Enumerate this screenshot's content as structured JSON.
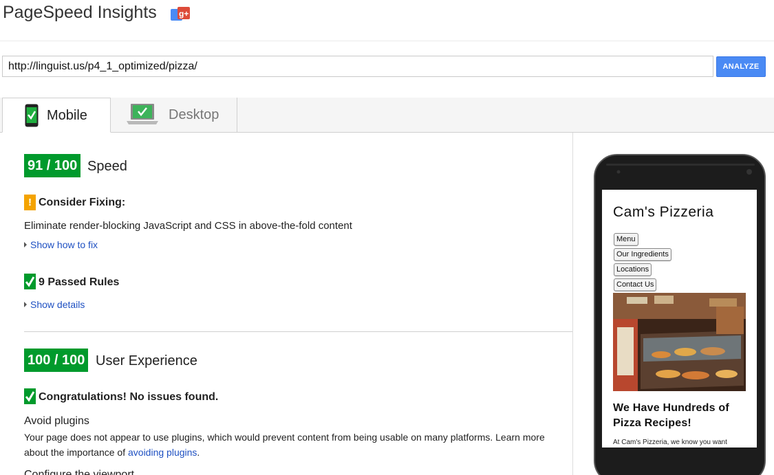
{
  "header": {
    "title": "PageSpeed Insights"
  },
  "search": {
    "url": "http://linguist.us/p4_1_optimized/pizza/",
    "analyze_label": "ANALYZE"
  },
  "tabs": [
    {
      "label": "Mobile",
      "active": true
    },
    {
      "label": "Desktop",
      "active": false
    }
  ],
  "speed": {
    "score": "91 / 100",
    "label": "Speed",
    "consider_heading": "Consider Fixing:",
    "consider_item": "Eliminate render-blocking JavaScript and CSS in above-the-fold content",
    "show_how": "Show how to fix",
    "passed_heading": "9 Passed Rules",
    "show_details": "Show details"
  },
  "ux": {
    "score": "100 / 100",
    "label": "User Experience",
    "congrats": "Congratulations! No issues found.",
    "rule1_title": "Avoid plugins",
    "rule1_text_a": "Your page does not appear to use plugins, which would prevent content from being usable on many platforms. Learn more about the importance of ",
    "rule1_link": "avoiding plugins",
    "rule1_text_b": ".",
    "rule2_title": "Configure the viewport"
  },
  "preview": {
    "site_title": "Cam's Pizzeria",
    "nav": [
      "Menu",
      "Our Ingredients",
      "Locations",
      "Contact Us"
    ],
    "headline": "We Have Hundreds of Pizza Recipes!",
    "paragraph": "At Cam's Pizzeria, we know you want"
  },
  "colors": {
    "score_green": "#009a2c",
    "warning_orange": "#f4a300",
    "analyze_blue": "#4a8af4",
    "link_blue": "#1e50c2"
  },
  "icons": {
    "header": "google-plus-icon",
    "mobile_tab": "smartphone-icon",
    "desktop_tab": "laptop-icon",
    "warning": "exclamation-icon",
    "passed": "check-icon"
  }
}
